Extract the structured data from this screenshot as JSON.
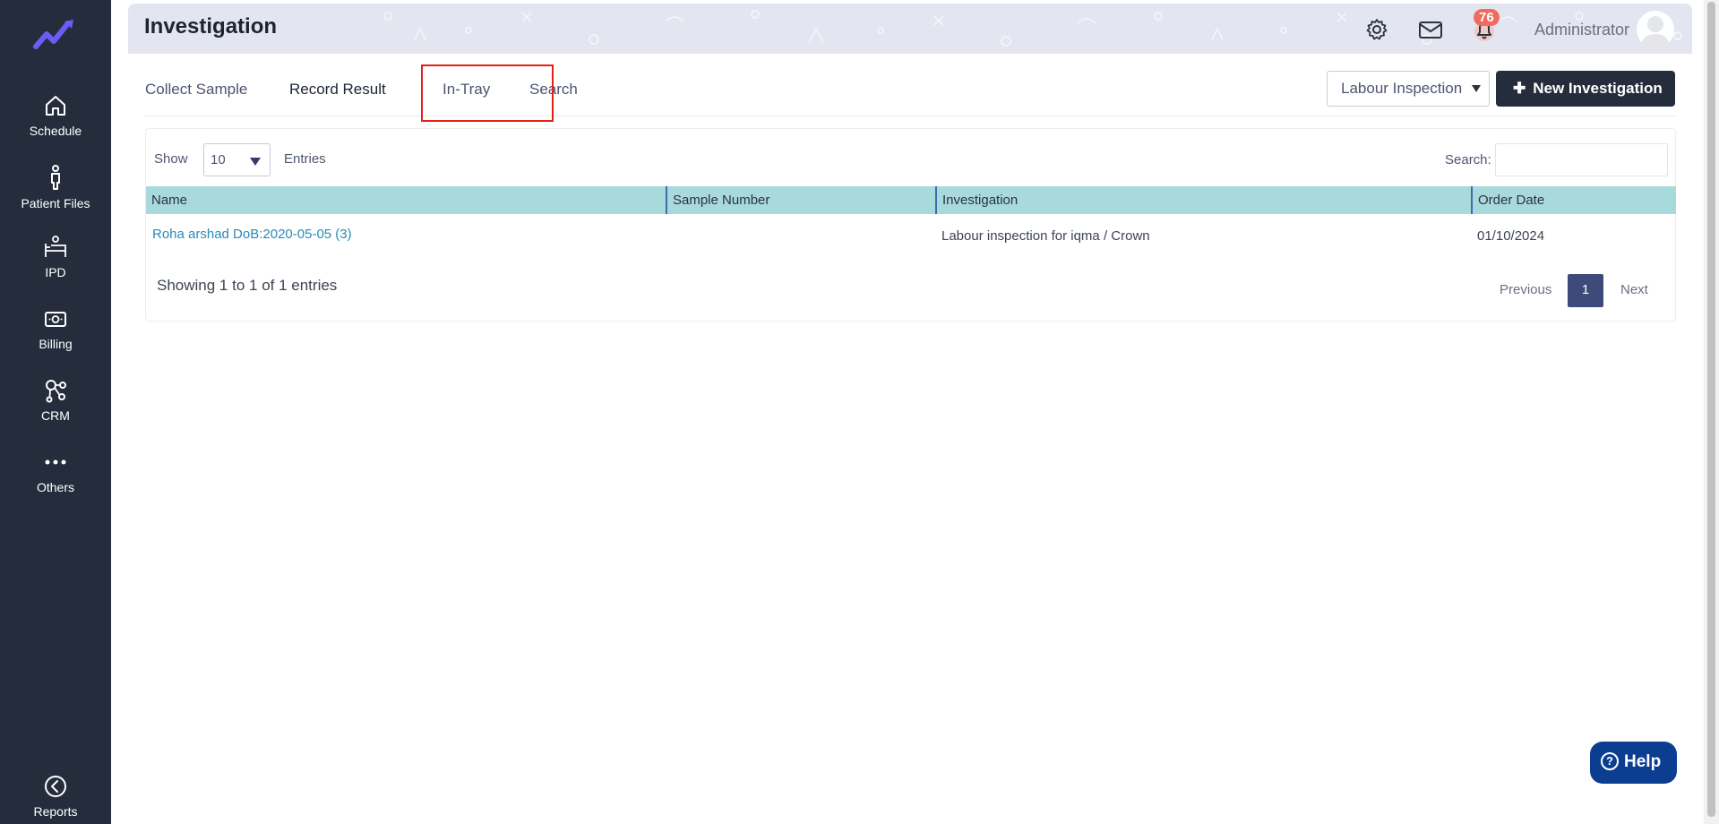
{
  "sidebar": {
    "items": [
      {
        "label": "Schedule",
        "icon": "home-icon"
      },
      {
        "label": "Patient Files",
        "icon": "person-icon"
      },
      {
        "label": "IPD",
        "icon": "bed-icon"
      },
      {
        "label": "Billing",
        "icon": "money-icon"
      },
      {
        "label": "CRM",
        "icon": "network-icon"
      },
      {
        "label": "Others",
        "icon": "more-icon"
      },
      {
        "label": "Reports",
        "icon": "chart-icon"
      }
    ]
  },
  "header": {
    "title": "Investigation",
    "notification_count": "76",
    "user_name": "Administrator"
  },
  "tabs": [
    {
      "label": "Collect Sample"
    },
    {
      "label": "Record Result"
    },
    {
      "label": "In-Tray"
    },
    {
      "label": "Search"
    }
  ],
  "toolbar": {
    "filter_value": "Labour Inspection",
    "new_button_label": "New Investigation"
  },
  "table": {
    "show_label": "Show",
    "page_size": "10",
    "entries_label": "Entries",
    "search_label": "Search:",
    "search_value": "",
    "columns": [
      "Name",
      "Sample Number",
      "Investigation",
      "Order Date"
    ],
    "rows": [
      {
        "name": "Roha arshad DoB:2020-05-05 (3)",
        "sample_number": "",
        "investigation": "Labour inspection for iqma / Crown",
        "order_date": "01/10/2024"
      }
    ],
    "summary": "Showing 1 to 1 of 1 entries",
    "previous_label": "Previous",
    "current_page": "1",
    "next_label": "Next"
  },
  "help": {
    "label": "Help"
  },
  "colors": {
    "sidebar_bg": "#252d3d",
    "table_header_bg": "#a8dadc",
    "primary_button": "#252d3d",
    "link": "#2a8ab8",
    "badge": "#ef6b5e",
    "help_button": "#0b3d91",
    "active_tab_outline": "#e0211c"
  }
}
